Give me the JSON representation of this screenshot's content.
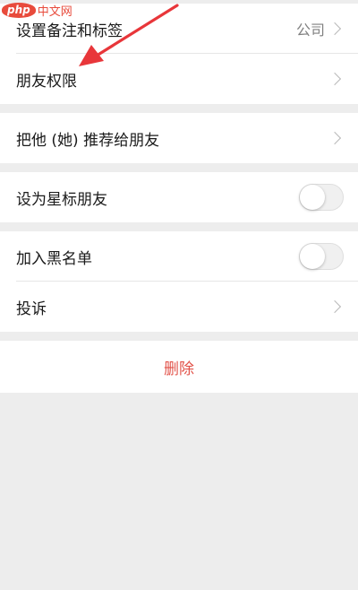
{
  "watermark": {
    "logo": "php",
    "text": "中文网"
  },
  "group1": {
    "items": [
      {
        "label": "设置备注和标签",
        "value": "公司",
        "icon": "chevron-right-icon"
      },
      {
        "label": "朋友权限",
        "icon": "chevron-right-icon"
      }
    ]
  },
  "group2": {
    "items": [
      {
        "label": "把他 (她) 推荐给朋友",
        "icon": "chevron-right-icon"
      }
    ]
  },
  "group3": {
    "items": [
      {
        "label": "设为星标朋友",
        "toggle": "off"
      }
    ]
  },
  "group4": {
    "items": [
      {
        "label": "加入黑名单",
        "toggle": "off"
      },
      {
        "label": "投诉",
        "icon": "chevron-right-icon"
      }
    ]
  },
  "delete": {
    "label": "删除",
    "color": "#e2534a"
  },
  "colors": {
    "background": "#ededed",
    "annotation_arrow": "#e8363a"
  }
}
